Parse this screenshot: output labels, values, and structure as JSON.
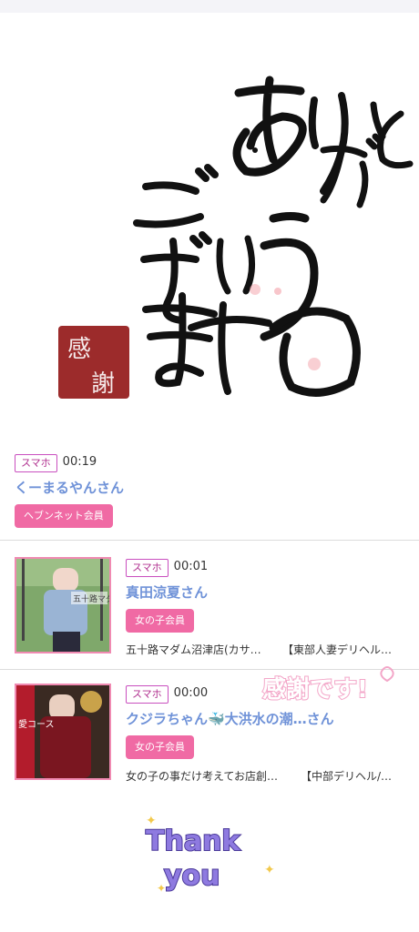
{
  "hero": {
    "calligraphy_lines": [
      "ありがとう",
      "ござい",
      "ます"
    ],
    "seal_text": "感謝"
  },
  "entries": [
    {
      "device": "スマホ",
      "time": "00:19",
      "name": "くーまるやんさん",
      "member": "ヘブンネット会員",
      "has_thumb": false
    },
    {
      "device": "スマホ",
      "time": "00:01",
      "name": "真田涼夏さん",
      "member": "女の子会員",
      "shop": "五十路マダム沼津店(カサ…",
      "category": "【東部人妻デリヘル…",
      "thumb_caption": "五十路マダム",
      "has_thumb": true
    },
    {
      "device": "スマホ",
      "time": "00:00",
      "name": "クジラちゃん🐳大洪水の潮…さん",
      "member": "女の子会員",
      "shop": "女の子の事だけ考えてお店創…",
      "category": "【中部デリヘル/…",
      "thumb_caption": "愛コース",
      "has_thumb": true
    }
  ],
  "stickers": {
    "kansha": "感謝です!",
    "thank_you_line1": "Thank",
    "thank_you_line2": "you"
  },
  "colors": {
    "accent_pink": "#f06aa4",
    "name_blue": "#6f92d8",
    "badge_border": "#c94fbf"
  }
}
